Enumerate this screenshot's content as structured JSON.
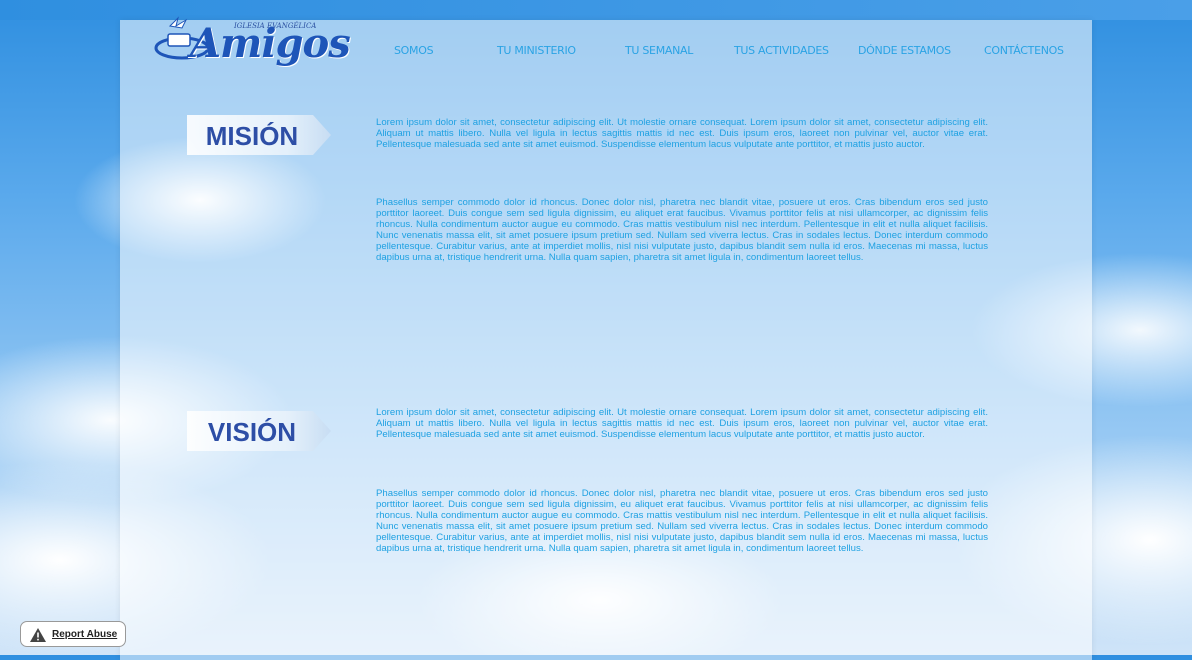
{
  "logo": {
    "small_text": "IGLESIA EVANGÉLICA",
    "name": "Amigos"
  },
  "nav": {
    "items": [
      {
        "label": "SOMOS"
      },
      {
        "label": "TU MINISTERIO"
      },
      {
        "label": "TU SEMANAL"
      },
      {
        "label": "TUS ACTIVIDADES"
      },
      {
        "label": "DÓNDE ESTAMOS"
      },
      {
        "label": "CONTÁCTENOS"
      }
    ]
  },
  "sections": [
    {
      "title": "MISIÓN",
      "paragraphs": [
        "Lorem ipsum dolor sit amet, consectetur adipiscing elit. Ut molestie ornare consequat. Lorem ipsum dolor sit amet, consectetur adipiscing elit. Aliquam ut mattis libero. Nulla vel ligula in lectus sagittis mattis id nec est. Duis ipsum eros, laoreet non pulvinar vel, auctor vitae erat. Pellentesque malesuada sed ante sit amet euismod. Suspendisse elementum lacus vulputate ante porttitor, et mattis justo auctor.",
        "Phasellus semper commodo dolor id rhoncus. Donec dolor nisl, pharetra nec blandit vitae, posuere ut eros. Cras bibendum eros sed justo porttitor laoreet. Duis congue sem sed ligula dignissim, eu aliquet erat faucibus. Vivamus porttitor felis at nisi ullamcorper, ac dignissim felis rhoncus. Nulla condimentum auctor augue eu commodo. Cras mattis vestibulum nisl nec interdum. Pellentesque in elit et nulla aliquet facilisis. Nunc venenatis massa elit, sit amet posuere ipsum pretium sed. Nullam sed viverra lectus. Cras in sodales lectus. Donec interdum commodo pellentesque. Curabitur varius, ante at imperdiet mollis, nisl nisi vulputate justo, dapibus blandit sem nulla id eros. Maecenas mi massa, luctus dapibus urna at, tristique hendrerit urna. Nulla quam sapien, pharetra sit amet ligula in, condimentum laoreet tellus."
      ]
    },
    {
      "title": "VISIÓN",
      "paragraphs": [
        "Lorem ipsum dolor sit amet, consectetur adipiscing elit. Ut molestie ornare consequat. Lorem ipsum dolor sit amet, consectetur adipiscing elit. Aliquam ut mattis libero. Nulla vel ligula in lectus sagittis mattis id nec est. Duis ipsum eros, laoreet non pulvinar vel, auctor vitae erat. Pellentesque malesuada sed ante sit amet euismod. Suspendisse elementum lacus vulputate ante porttitor, et mattis justo auctor.",
        "Phasellus semper commodo dolor id rhoncus. Donec dolor nisl, pharetra nec blandit vitae, posuere ut eros. Cras bibendum eros sed justo porttitor laoreet. Duis congue sem sed ligula dignissim, eu aliquet erat faucibus. Vivamus porttitor felis at nisi ullamcorper, ac dignissim felis rhoncus. Nulla condimentum auctor augue eu commodo. Cras mattis vestibulum nisl nec interdum. Pellentesque in elit et nulla aliquet facilisis. Nunc venenatis massa elit, sit amet posuere ipsum pretium sed. Nullam sed viverra lectus. Cras in sodales lectus. Donec interdum commodo pellentesque. Curabitur varius, ante at imperdiet mollis, nisl nisi vulputate justo, dapibus blandit sem nulla id eros. Maecenas mi massa, luctus dapibus urna at, tristique hendrerit urna. Nulla quam sapien, pharetra sit amet ligula in, condimentum laoreet tellus."
      ]
    }
  ],
  "report_abuse": {
    "label": "Report Abuse",
    "icon": "warning-icon"
  },
  "colors": {
    "nav_text": "#2aa3e4",
    "body_text": "#1fa1e2",
    "title_text": "#2d4ea6",
    "logo_blue": "#1e55b8"
  }
}
